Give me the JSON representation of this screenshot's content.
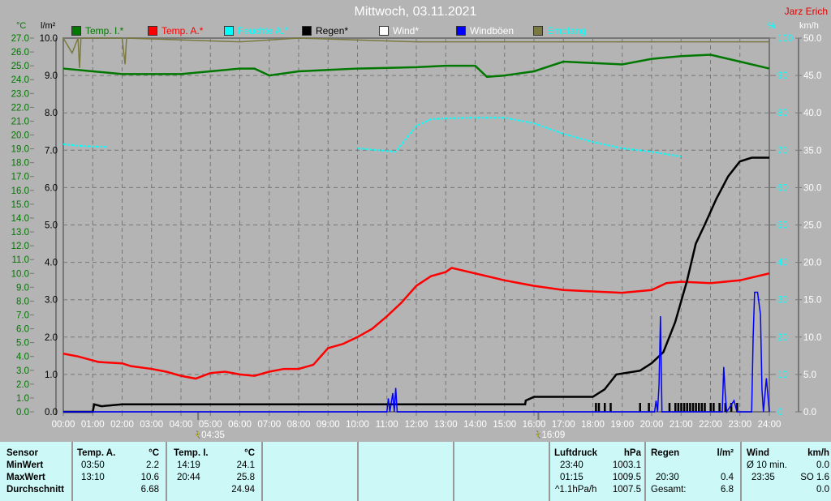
{
  "title": "Mittwoch, 03.11.2021",
  "author": "Jarz Erich",
  "legend": [
    {
      "label": "Temp. I.*",
      "color": "#007800",
      "text_color": "#007800"
    },
    {
      "label": "Temp. A.*",
      "color": "#ff0000",
      "text_color": "#ff0000"
    },
    {
      "label": "Feuchte A.*",
      "color": "#00ffff",
      "text_color": "#00ffff"
    },
    {
      "label": "Regen*",
      "color": "#000000",
      "text_color": "#000000"
    },
    {
      "label": "Wind*",
      "color": "#ffffff",
      "text_color": "#ffffff"
    },
    {
      "label": "Windböen",
      "color": "#0000ff",
      "text_color": "#ffffff"
    },
    {
      "label": "Empfang",
      "color": "#7a7a40",
      "text_color": "#00ffff"
    }
  ],
  "units": {
    "temp": "°C",
    "rain": "l/m²",
    "humidity": "%",
    "wind": "km/h"
  },
  "chart_data": {
    "type": "line",
    "x_range_hours": [
      0,
      24
    ],
    "x_tick_labels": [
      "00:00",
      "01:00",
      "02:00",
      "03:00",
      "04:00",
      "05:00",
      "06:00",
      "07:00",
      "08:00",
      "09:00",
      "10:00",
      "11:00",
      "12:00",
      "13:00",
      "14:00",
      "15:00",
      "16:00",
      "17:00",
      "18:00",
      "19:00",
      "20:00",
      "21:00",
      "22:00",
      "23:00",
      "24:00"
    ],
    "sunrise": {
      "hour": 4.583,
      "label": "04:35"
    },
    "sunset": {
      "hour": 16.15,
      "label": "16:09"
    },
    "axes": {
      "temp": {
        "range": [
          0,
          27
        ],
        "labels": [
          "0.0",
          "1.0",
          "2.0",
          "3.0",
          "4.0",
          "5.0",
          "6.0",
          "7.0",
          "8.0",
          "9.0",
          "10.0",
          "11.0",
          "12.0",
          "13.0",
          "14.0",
          "15.0",
          "16.0",
          "17.0",
          "18.0",
          "19.0",
          "20.0",
          "21.0",
          "22.0",
          "23.0",
          "24.0",
          "25.0",
          "26.0",
          "27.0"
        ]
      },
      "rain": {
        "range": [
          0,
          10
        ],
        "labels": [
          "0.0",
          "1.0",
          "2.0",
          "3.0",
          "4.0",
          "5.0",
          "6.0",
          "7.0",
          "8.0",
          "9.0",
          "10.0"
        ]
      },
      "humidity": {
        "range": [
          0,
          100
        ],
        "labels": [
          "0",
          "10",
          "20",
          "30",
          "40",
          "50",
          "60",
          "70",
          "80",
          "90",
          "100"
        ]
      },
      "wind": {
        "range": [
          0,
          50
        ],
        "labels": [
          "0.0",
          "5.0",
          "10.0",
          "15.0",
          "20.0",
          "25.0",
          "30.0",
          "35.0",
          "40.0",
          "45.0",
          "50.0"
        ]
      }
    },
    "series": [
      {
        "name": "Temp. I.*",
        "axis": "temp",
        "color": "#007800",
        "points": [
          [
            0,
            24.8
          ],
          [
            1,
            24.6
          ],
          [
            2,
            24.4
          ],
          [
            3,
            24.4
          ],
          [
            4,
            24.4
          ],
          [
            5,
            24.6
          ],
          [
            6,
            24.8
          ],
          [
            6.5,
            24.8
          ],
          [
            7,
            24.3
          ],
          [
            8,
            24.6
          ],
          [
            9,
            24.7
          ],
          [
            10,
            24.8
          ],
          [
            12,
            24.9
          ],
          [
            13,
            25.0
          ],
          [
            14,
            25.0
          ],
          [
            14.4,
            24.2
          ],
          [
            15,
            24.3
          ],
          [
            16,
            24.6
          ],
          [
            17,
            25.3
          ],
          [
            18,
            25.2
          ],
          [
            19,
            25.1
          ],
          [
            20,
            25.5
          ],
          [
            21,
            25.7
          ],
          [
            22,
            25.8
          ],
          [
            23,
            25.3
          ],
          [
            24,
            24.8
          ]
        ]
      },
      {
        "name": "Temp. A.*",
        "axis": "temp",
        "color": "#ff0000",
        "points": [
          [
            0,
            4.2
          ],
          [
            0.5,
            4.0
          ],
          [
            1.2,
            3.6
          ],
          [
            2,
            3.5
          ],
          [
            2.3,
            3.3
          ],
          [
            3,
            3.1
          ],
          [
            3.5,
            2.9
          ],
          [
            4,
            2.6
          ],
          [
            4.5,
            2.4
          ],
          [
            5,
            2.8
          ],
          [
            5.5,
            2.9
          ],
          [
            6,
            2.7
          ],
          [
            6.5,
            2.6
          ],
          [
            7,
            2.9
          ],
          [
            7.5,
            3.1
          ],
          [
            8,
            3.1
          ],
          [
            8.5,
            3.4
          ],
          [
            9,
            4.6
          ],
          [
            9.5,
            4.9
          ],
          [
            10,
            5.4
          ],
          [
            10.5,
            6.0
          ],
          [
            11,
            6.9
          ],
          [
            11.5,
            7.9
          ],
          [
            12,
            9.1
          ],
          [
            12.5,
            9.8
          ],
          [
            13,
            10.1
          ],
          [
            13.2,
            10.4
          ],
          [
            14,
            10.0
          ],
          [
            15,
            9.5
          ],
          [
            16,
            9.1
          ],
          [
            17,
            8.8
          ],
          [
            18,
            8.7
          ],
          [
            19,
            8.6
          ],
          [
            20,
            8.8
          ],
          [
            20.5,
            9.3
          ],
          [
            21,
            9.4
          ],
          [
            22,
            9.3
          ],
          [
            23,
            9.5
          ],
          [
            24,
            10.0
          ]
        ]
      },
      {
        "name": "Feuchte A.*",
        "axis": "humidity",
        "color": "#00ffff",
        "segments": [
          [
            [
              0,
              71.6
            ],
            [
              0.5,
              71.2
            ],
            [
              1,
              71.0
            ],
            [
              1.5,
              70.9
            ]
          ],
          [
            [
              10,
              70.5
            ],
            [
              11,
              69.8
            ],
            [
              11.3,
              69.6
            ],
            [
              12,
              76.5
            ],
            [
              12.5,
              78.3
            ],
            [
              13,
              78.5
            ],
            [
              14,
              78.7
            ],
            [
              15,
              78.7
            ],
            [
              16,
              77.2
            ],
            [
              17,
              74.4
            ],
            [
              18,
              72.2
            ],
            [
              19,
              70.5
            ],
            [
              20,
              69.6
            ],
            [
              21,
              68.3
            ]
          ]
        ]
      },
      {
        "name": "Regen*",
        "axis": "rain",
        "color": "#000000",
        "points": [
          [
            0,
            0
          ],
          [
            1.0,
            0
          ],
          [
            1.05,
            0.2
          ],
          [
            1.3,
            0.15
          ],
          [
            2,
            0.2
          ],
          [
            15.7,
            0.2
          ],
          [
            15.72,
            0.3
          ],
          [
            16,
            0.4
          ],
          [
            18,
            0.4
          ],
          [
            18.4,
            0.6
          ],
          [
            18.8,
            1.0
          ],
          [
            19.6,
            1.1
          ],
          [
            20,
            1.3
          ],
          [
            20.4,
            1.6
          ],
          [
            20.8,
            2.4
          ],
          [
            21.2,
            3.5
          ],
          [
            21.5,
            4.5
          ],
          [
            21.8,
            5.0
          ],
          [
            22.2,
            5.7
          ],
          [
            22.6,
            6.3
          ],
          [
            23,
            6.7
          ],
          [
            23.4,
            6.8
          ],
          [
            24,
            6.8
          ]
        ]
      },
      {
        "name": "Windböen",
        "axis": "wind",
        "color": "#0000ff",
        "points": [
          [
            0,
            0
          ],
          [
            11.0,
            0
          ],
          [
            11.05,
            1.8
          ],
          [
            11.1,
            0
          ],
          [
            11.2,
            2.5
          ],
          [
            11.25,
            0
          ],
          [
            11.3,
            3.2
          ],
          [
            11.35,
            0
          ],
          [
            20.1,
            0
          ],
          [
            20.15,
            1.5
          ],
          [
            20.2,
            0
          ],
          [
            20.25,
            3.5
          ],
          [
            20.3,
            12.8
          ],
          [
            20.35,
            0
          ],
          [
            22.4,
            0
          ],
          [
            22.45,
            6.0
          ],
          [
            22.5,
            2.5
          ],
          [
            22.55,
            0
          ],
          [
            22.8,
            1.5
          ],
          [
            22.9,
            0
          ],
          [
            23.4,
            0
          ],
          [
            23.45,
            10
          ],
          [
            23.5,
            16.0
          ],
          [
            23.6,
            16.0
          ],
          [
            23.7,
            13
          ],
          [
            23.75,
            3
          ],
          [
            23.8,
            0
          ],
          [
            23.9,
            4.5
          ],
          [
            24,
            0
          ]
        ]
      },
      {
        "name": "Empfang",
        "axis": "humidity",
        "color": "#7a7a40",
        "points": [
          [
            0,
            100
          ],
          [
            0.3,
            96
          ],
          [
            0.5,
            100
          ],
          [
            0.55,
            92
          ],
          [
            0.6,
            100
          ],
          [
            2,
            100
          ],
          [
            2.1,
            93
          ],
          [
            2.15,
            100
          ],
          [
            6,
            99
          ],
          [
            8,
            100
          ],
          [
            12,
            99
          ],
          [
            16,
            99
          ],
          [
            24,
            99
          ]
        ]
      }
    ],
    "rain_bars_hours": [
      18.1,
      18.2,
      18.4,
      18.6,
      19.6,
      19.9,
      20.6,
      20.8,
      20.9,
      21.0,
      21.1,
      21.2,
      21.3,
      21.4,
      21.5,
      21.6,
      21.7,
      21.8,
      22.0,
      22.1,
      22.3,
      22.5,
      22.7,
      22.9
    ]
  },
  "table": {
    "sensor": {
      "header": "Sensor",
      "rows": [
        "MinWert",
        "MaxWert",
        "Durchschnitt"
      ]
    },
    "temp_a": {
      "header": "Temp. A.",
      "unit": "°C",
      "min_time": "03:50",
      "min": "2.2",
      "max_time": "13:10",
      "max": "10.6",
      "avg": "6.68"
    },
    "temp_i": {
      "header": "Temp. I.",
      "unit": "°C",
      "min_time": "14:19",
      "min": "24.1",
      "max_time": "20:44",
      "max": "25.8",
      "avg": "24.94"
    },
    "pressure": {
      "header": "Luftdruck",
      "unit": "hPa",
      "min_time": "23:40",
      "min": "1003.1",
      "max_time": "01:15",
      "max": "1009.5",
      "trend": "^1.1hPa/h",
      "avg": "1007.5"
    },
    "rain": {
      "header": "Regen",
      "unit": "l/m²",
      "max_time": "20:30",
      "max": "0.4",
      "total_label": "Gesamt:",
      "total": "6.8"
    },
    "wind": {
      "header": "Wind",
      "unit": "km/h",
      "avg_label": "Ø 10 min.",
      "avg": "0.0",
      "max_time": "23:35",
      "max": "SO 1.6",
      "third": "0.0"
    }
  }
}
